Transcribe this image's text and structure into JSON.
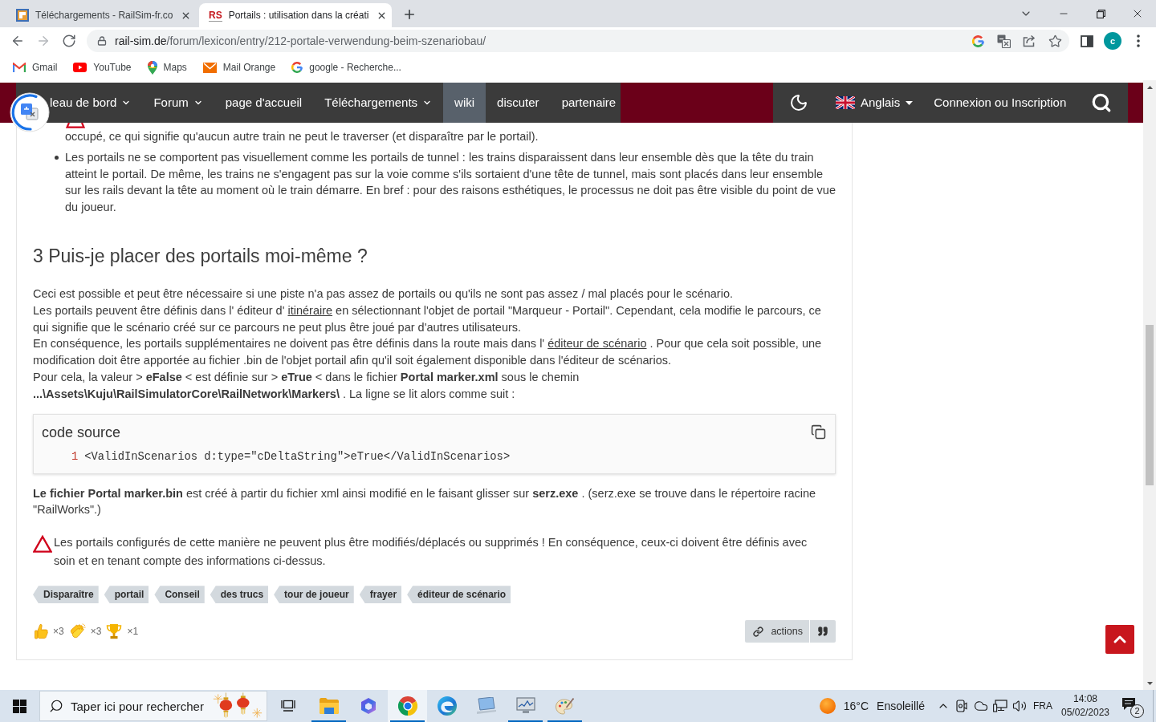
{
  "browser": {
    "tabs": [
      {
        "title": "Téléchargements - RailSim-fr.co",
        "selected": false,
        "favicon": {
          "kind": "picture"
        }
      },
      {
        "title": "Portails : utilisation dans la créati",
        "selected": true,
        "favicon": {
          "kind": "letters",
          "text": "RS"
        }
      }
    ],
    "nav_buttons": [
      {
        "kind": "back",
        "disabled": false
      },
      {
        "kind": "forward",
        "disabled": true
      },
      {
        "kind": "reload",
        "disabled": false
      }
    ],
    "address": {
      "host": "rail-sim.de",
      "path": "/forum/lexicon/entry/212-portale-verwendung-beim-szenariobau/"
    },
    "profile_initial": "c",
    "bookmarks": [
      {
        "label": "Gmail",
        "kind": "gmail"
      },
      {
        "label": "YouTube",
        "kind": "youtube"
      },
      {
        "label": "Maps",
        "kind": "maps"
      },
      {
        "label": "Mail Orange",
        "kind": "mail"
      },
      {
        "label": "google - Recherche...",
        "kind": "google"
      }
    ]
  },
  "site_nav": {
    "items": [
      {
        "label": "leau de bord",
        "dropdown": true,
        "selected": false
      },
      {
        "label": "Forum",
        "dropdown": true,
        "selected": false
      },
      {
        "label": "page d'accueil",
        "dropdown": false,
        "selected": false
      },
      {
        "label": "Téléchargements",
        "dropdown": true,
        "selected": false
      },
      {
        "label": "wiki",
        "dropdown": false,
        "selected": true
      },
      {
        "label": "discuter",
        "dropdown": false,
        "selected": false
      },
      {
        "label": "partenaire",
        "dropdown": false,
        "selected": false
      }
    ],
    "language": "Anglais",
    "login": "Connexion ou Inscription"
  },
  "article": {
    "continued_text": "occupé, ce qui signifie qu'aucun autre train ne peut le traverser (et disparaître par le portail).",
    "bullets": [
      "Les portails ne se comportent pas visuellement comme les portails de tunnel : les trains disparaissent dans leur ensemble dès que la tête du train atteint le portail. De même, les trains ne s'engagent pas sur la voie comme s'ils sortaient d'une tête de tunnel, mais sont placés dans leur ensemble sur les rails devant la tête au moment où le train démarre. En bref : pour des raisons esthétiques, le processus ne doit pas être visible du point de vue du joueur."
    ],
    "heading": "3 Puis-je placer des portails moi-même ?",
    "paragraph_lines": [
      [
        {
          "kind": "text",
          "text": "Ceci est possible et peut être nécessaire si une piste n'a pas assez de portails ou qu'ils ne sont pas assez / mal placés pour le scénario."
        }
      ],
      [
        {
          "kind": "text",
          "text": "Les portails peuvent être définis dans l' éditeur d' "
        },
        {
          "kind": "link",
          "text": "itinéraire"
        },
        {
          "kind": "text",
          "text": " en sélectionnant l'objet de portail \"Marqueur - Portail\". Cependant, cela modifie le parcours, ce qui signifie que le scénario créé sur ce parcours ne peut plus être joué par d'autres utilisateurs."
        }
      ],
      [
        {
          "kind": "text",
          "text": "En conséquence, les portails supplémentaires ne doivent pas être définis dans la route mais dans l' "
        },
        {
          "kind": "link",
          "text": "éditeur de scénario"
        },
        {
          "kind": "text",
          "text": " . Pour que cela soit possible, une modification doit être apportée au fichier .bin de l'objet portail afin qu'il soit également disponible dans l'éditeur de scénarios."
        }
      ],
      [
        {
          "kind": "text",
          "text": "Pour cela, la valeur > **eFalse** < est définie sur > **eTrue** < dans le fichier **Portal marker.xml** sous le chemin **...\\Assets\\Kuju\\RailSimulatorCore\\RailNetwork\\Markers\\** . La ligne se lit alors comme suit :"
        }
      ]
    ],
    "code_block": {
      "title": "code source",
      "lines": [
        {
          "number": "1",
          "code": "<ValidInScenarios d:type=\"cDeltaString\">eTrue</ValidInScenarios>"
        }
      ]
    },
    "note": "**Le fichier Portal marker.bin** est créé à partir du fichier xml ainsi modifié en le faisant glisser sur **serz.exe** . (serz.exe se trouve dans le répertoire racine \"RailWorks\".)",
    "warning": "Les portails configurés de cette manière ne peuvent plus être modifiés/déplacés ou supprimés ! En conséquence, ceux-ci doivent être définis avec soin et en tenant compte des informations ci-dessus.",
    "tags": [
      "Disparaître",
      "portail",
      "Conseil",
      "des trucs",
      "tour de joueur",
      "frayer",
      "éditeur de scénario"
    ],
    "reactions": [
      {
        "kind": "like",
        "count": "×3"
      },
      {
        "kind": "thanks",
        "count": "×3"
      },
      {
        "kind": "trophy",
        "count": "×1"
      }
    ],
    "actions_label": "actions"
  },
  "taskbar": {
    "search": {
      "placeholder": "Taper ici pour rechercher"
    },
    "apps": [
      {
        "kind": "explorer",
        "running": true,
        "selected": false
      },
      {
        "kind": "office",
        "running": false,
        "selected": false
      },
      {
        "kind": "chrome",
        "running": true,
        "selected": true
      },
      {
        "kind": "edge",
        "running": false,
        "selected": false
      },
      {
        "kind": "pc",
        "running": false,
        "selected": false
      },
      {
        "kind": "monitor",
        "running": true,
        "selected": false
      },
      {
        "kind": "paint",
        "running": true,
        "selected": false
      }
    ],
    "weather": {
      "temperature": "16°C",
      "condition": "Ensoleillé"
    },
    "tray": [
      {
        "kind": "camera"
      },
      {
        "kind": "cloud"
      },
      {
        "kind": "network"
      },
      {
        "kind": "volume"
      }
    ],
    "input_language": "FRA",
    "time": "14:08",
    "date": "05/02/2023",
    "notifications": "2"
  }
}
